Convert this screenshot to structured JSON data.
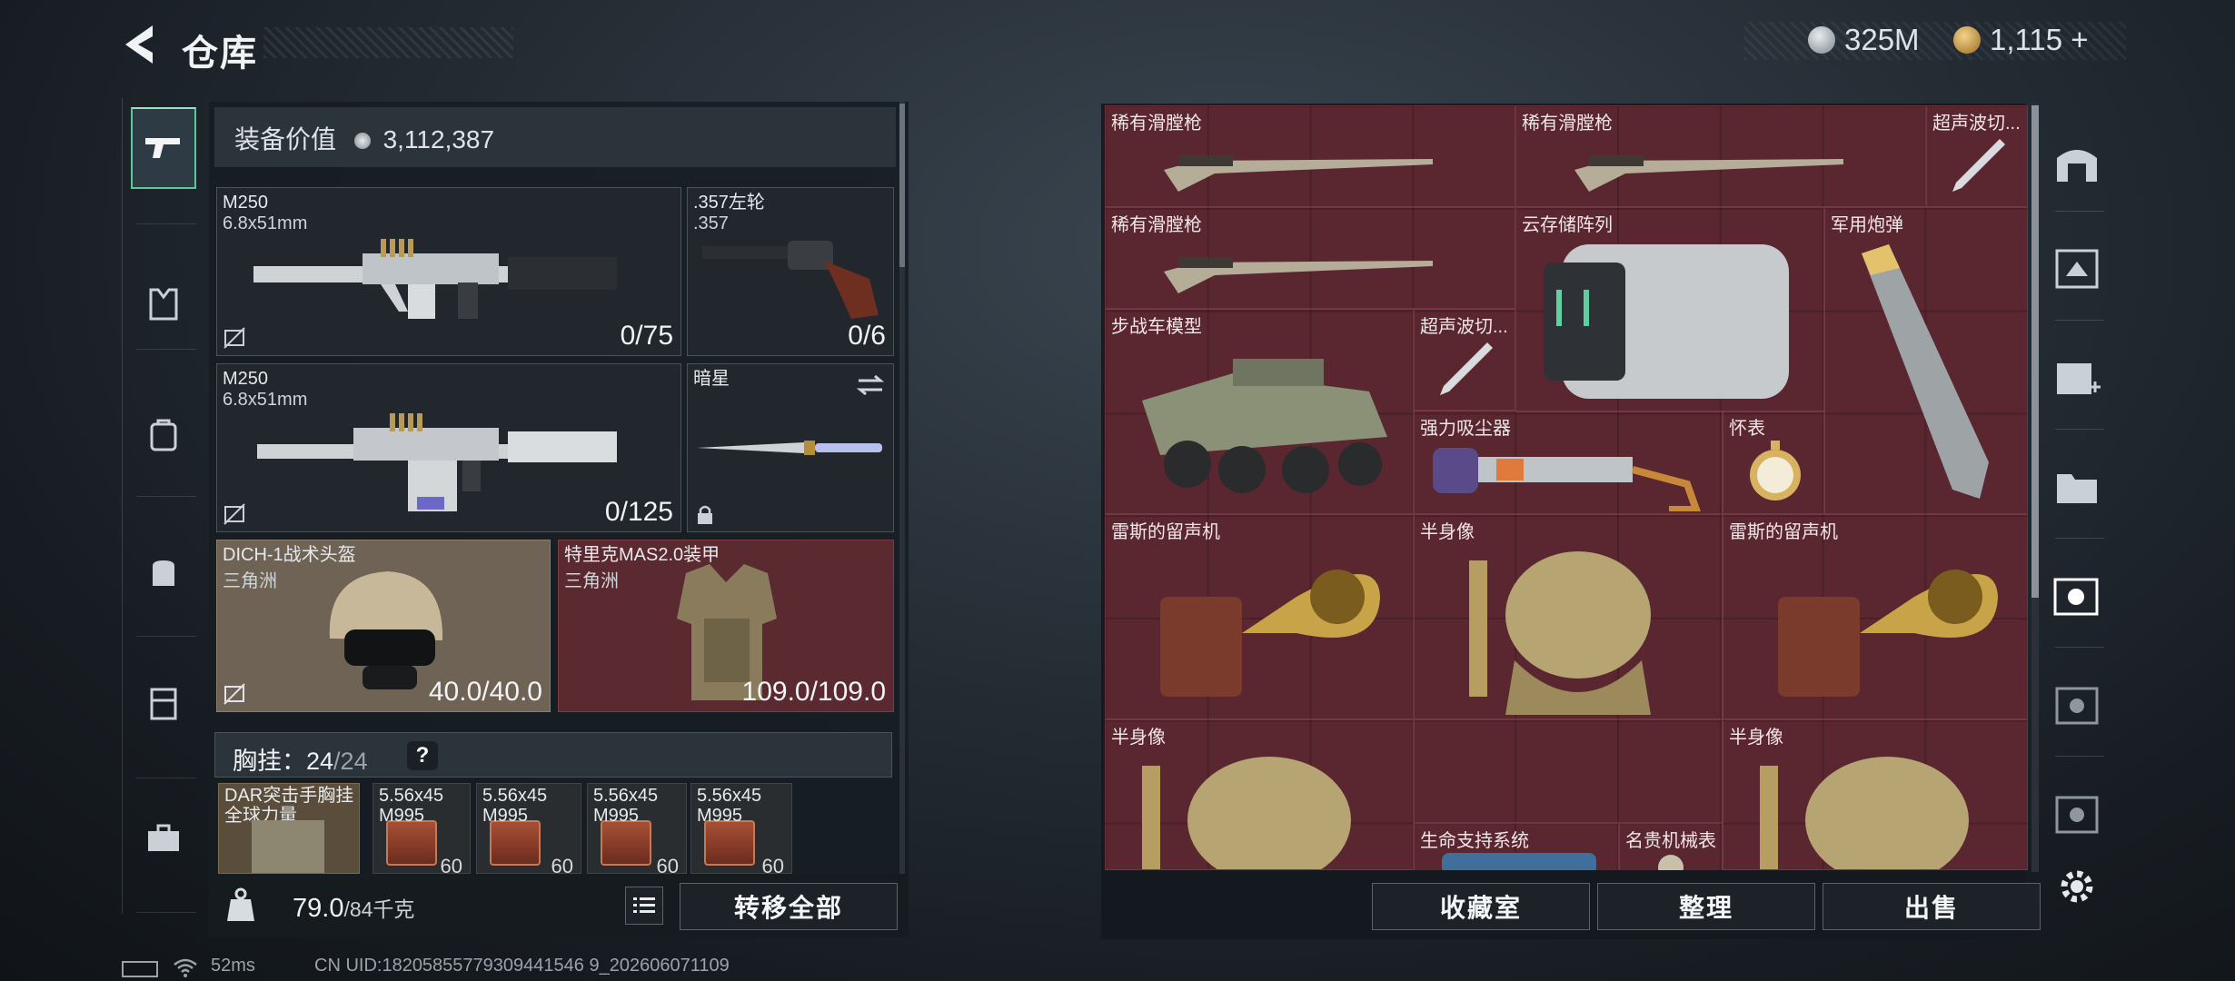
{
  "header": {
    "title": "仓库"
  },
  "currency": {
    "silver": "325M",
    "gold": "1,115 +"
  },
  "sidebar": {
    "items": [
      "weapons",
      "armor",
      "backpack",
      "bag",
      "locker",
      "toolbox"
    ]
  },
  "equipment_value": {
    "label": "装备价值",
    "value": "3,112,387"
  },
  "slots": [
    {
      "name": "M250",
      "sub": "6.8x51mm",
      "count": "0/75"
    },
    {
      "name": ".357左轮",
      "sub": ".357",
      "count": "0/6"
    },
    {
      "name": "M250",
      "sub": "6.8x51mm",
      "count": "0/125"
    },
    {
      "name": "暗星",
      "sub": "",
      "count": ""
    },
    {
      "name": "DICH-1战术头盔",
      "sub": "三角洲",
      "count": "40.0/40.0"
    },
    {
      "name": "特里克MAS2.0装甲",
      "sub": "三角洲",
      "count": "109.0/109.0"
    }
  ],
  "chest": {
    "label": "胸挂：",
    "current": "24",
    "max": "/24",
    "help": "?"
  },
  "chest_items": [
    {
      "name": "DAR突击手胸挂",
      "sub": "全球力量"
    },
    {
      "name": "5.56x45",
      "sub": "M995",
      "qty": "60"
    },
    {
      "name": "5.56x45",
      "sub": "M995",
      "qty": "60"
    },
    {
      "name": "5.56x45",
      "sub": "M995",
      "qty": "60"
    },
    {
      "name": "5.56x45",
      "sub": "M995",
      "qty": "60"
    }
  ],
  "weight": {
    "current": "79.0",
    "max": "/84千克"
  },
  "buttons": {
    "transfer_all": "转移全部",
    "collection": "收藏室",
    "sort": "整理",
    "sell": "出售"
  },
  "stash_items": [
    "稀有滑膛枪",
    "稀有滑膛枪",
    "超声波切...",
    "稀有滑膛枪",
    "云存储阵列",
    "军用炮弹",
    "步战车模型",
    "超声波切...",
    "强力吸尘器",
    "怀表",
    "雷斯的留声机",
    "雷斯的留声机",
    "半身像",
    "半身像",
    "半身像",
    "生命支持系统",
    "名贵机械表"
  ],
  "status": {
    "ping": "52ms",
    "uid": "CN UID:18205855779309441546 9_202606071109"
  },
  "colors": {
    "accent": "#59c89a",
    "stash_bg": "#5a2730",
    "panel": "#21272d"
  }
}
